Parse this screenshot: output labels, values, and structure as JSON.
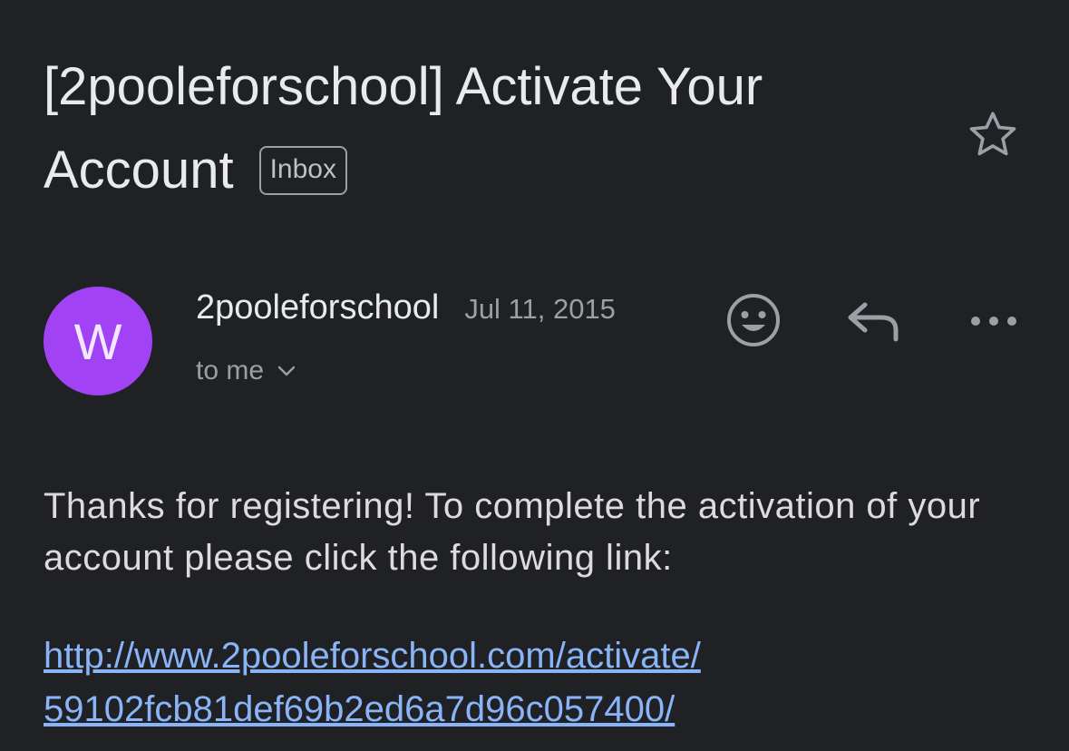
{
  "email": {
    "subject_line_1": "[2pooleforschool] Activate Your",
    "subject_line_2": "Account",
    "label": "Inbox",
    "sender": {
      "avatar_letter": "W",
      "avatar_color": "#a142f4",
      "name": "2pooleforschool",
      "date": "Jul 11, 2015",
      "recipient": "to me"
    },
    "body": "Thanks for registering! To complete the activation of your account please click the following link:",
    "link_line_1": "http://www.2pooleforschool.com/activate/",
    "link_line_2": "59102fcb81def69b2ed6a7d96c057400/"
  },
  "icons": {
    "star": "star-icon",
    "emoji": "smiley-icon",
    "reply": "reply-icon",
    "more": "more-horizontal-icon",
    "chevron": "chevron-down-icon"
  },
  "colors": {
    "background": "#202124",
    "link": "#8ab4f8",
    "secondary_text": "#9aa0a6"
  }
}
